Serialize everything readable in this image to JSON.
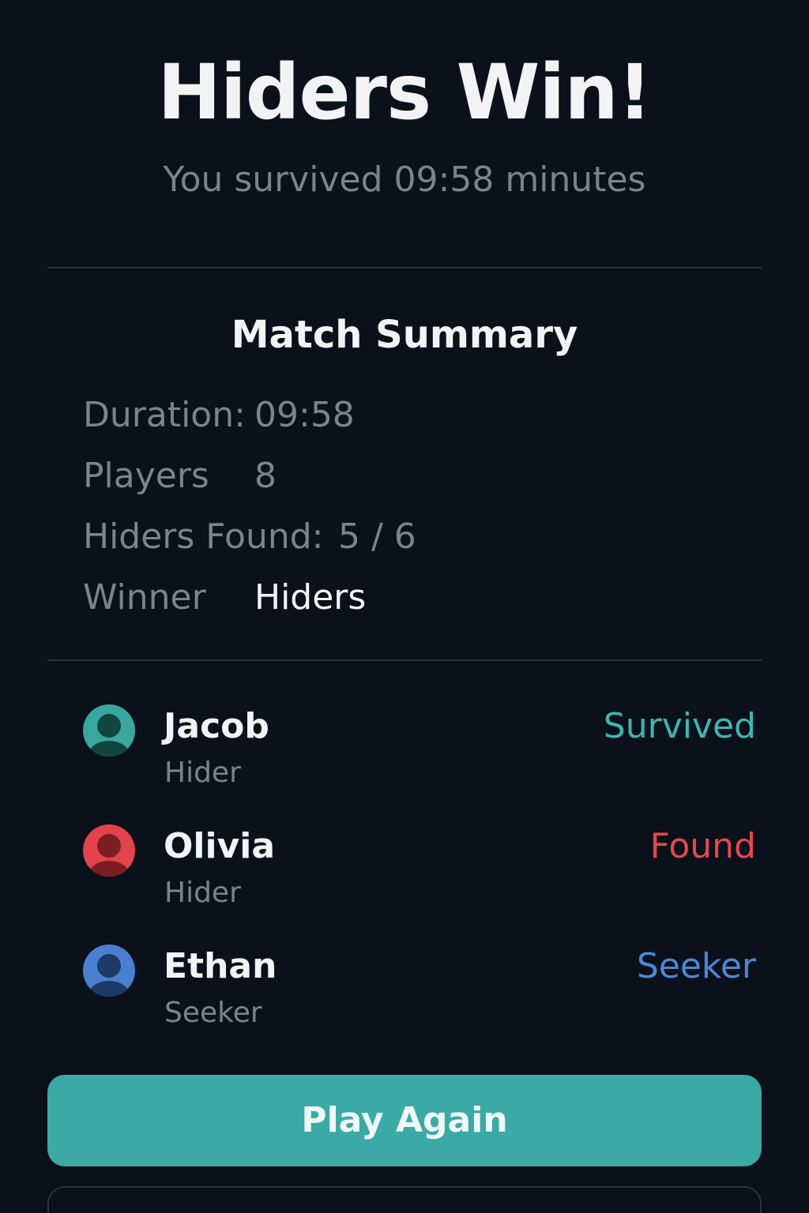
{
  "header": {
    "title": "Hiders Win!",
    "subtitle": "You survived 09:58 minutes"
  },
  "summary": {
    "title": "Match Summary",
    "stats": [
      {
        "label": "Duration:",
        "value": "09:58"
      },
      {
        "label": "Players",
        "value": "8"
      },
      {
        "label": "Hiders Found:",
        "value": "5 / 6"
      },
      {
        "label": "Winner",
        "value": "Hiders"
      }
    ]
  },
  "players": [
    {
      "name": "Jacob",
      "role": "Hider",
      "status": "Survived",
      "status_color": "#3fb5b0",
      "avatar_color": "#3aa79f",
      "avatar_dark": "#10463f",
      "icon": "user-avatar-icon"
    },
    {
      "name": "Olivia",
      "role": "Hider",
      "status": "Found",
      "status_color": "#e5474f",
      "avatar_color": "#e3434a",
      "avatar_dark": "#7b1f24",
      "icon": "user-avatar-icon"
    },
    {
      "name": "Ethan",
      "role": "Seeker",
      "status": "Seeker",
      "status_color": "#4f86d6",
      "avatar_color": "#4a7fd0",
      "avatar_dark": "#1d3a66",
      "icon": "user-avatar-icon"
    }
  ],
  "actions": {
    "play_again_label": "Play Again",
    "secondary_label": ""
  },
  "colors": {
    "background": "#0a111a",
    "accent": "#3ba9a5",
    "divider": "#2a3440",
    "muted_text": "#7a838e"
  }
}
